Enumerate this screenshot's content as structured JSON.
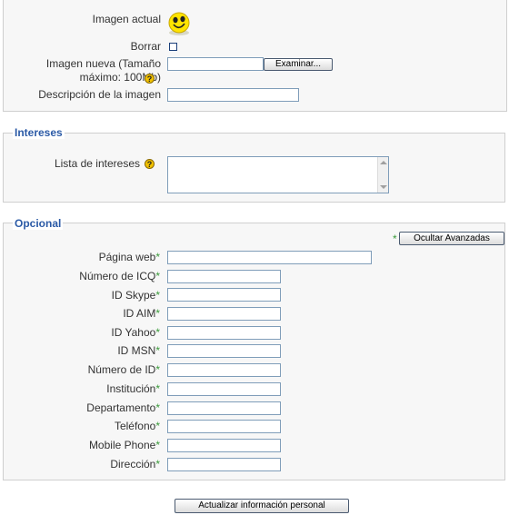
{
  "image_section": {
    "current_image_label": "Imagen actual",
    "delete_label": "Borrar",
    "new_image_label": "Imagen nueva (Tamaño máximo: 100Mb)",
    "browse_button": "Examinar...",
    "description_label": "Descripción de la imagen"
  },
  "interests": {
    "legend": "Intereses",
    "list_label": "Lista de intereses"
  },
  "optional": {
    "legend": "Opcional",
    "hide_advanced_button": "Ocultar Avanzadas",
    "advanced_marker": "*",
    "fields": [
      {
        "label": "Página web",
        "marker": "*"
      },
      {
        "label": "Número de ICQ",
        "marker": "*"
      },
      {
        "label": "ID Skype",
        "marker": "*"
      },
      {
        "label": "ID AIM",
        "marker": "*"
      },
      {
        "label": "ID Yahoo",
        "marker": "*"
      },
      {
        "label": "ID MSN",
        "marker": "*"
      },
      {
        "label": "Número de ID",
        "marker": "*"
      },
      {
        "label": "Institución",
        "marker": "*"
      },
      {
        "label": "Departamento",
        "marker": "*"
      },
      {
        "label": "Teléfono",
        "marker": "*"
      },
      {
        "label": "Mobile Phone",
        "marker": "*"
      },
      {
        "label": "Dirección",
        "marker": "*"
      }
    ]
  },
  "submit_button": "Actualizar información personal",
  "help_glyph": "?",
  "colors": {
    "legend": "#2b5aa6",
    "required_marker": "#3a9a3a",
    "panel_bg": "#f7f7f7"
  }
}
